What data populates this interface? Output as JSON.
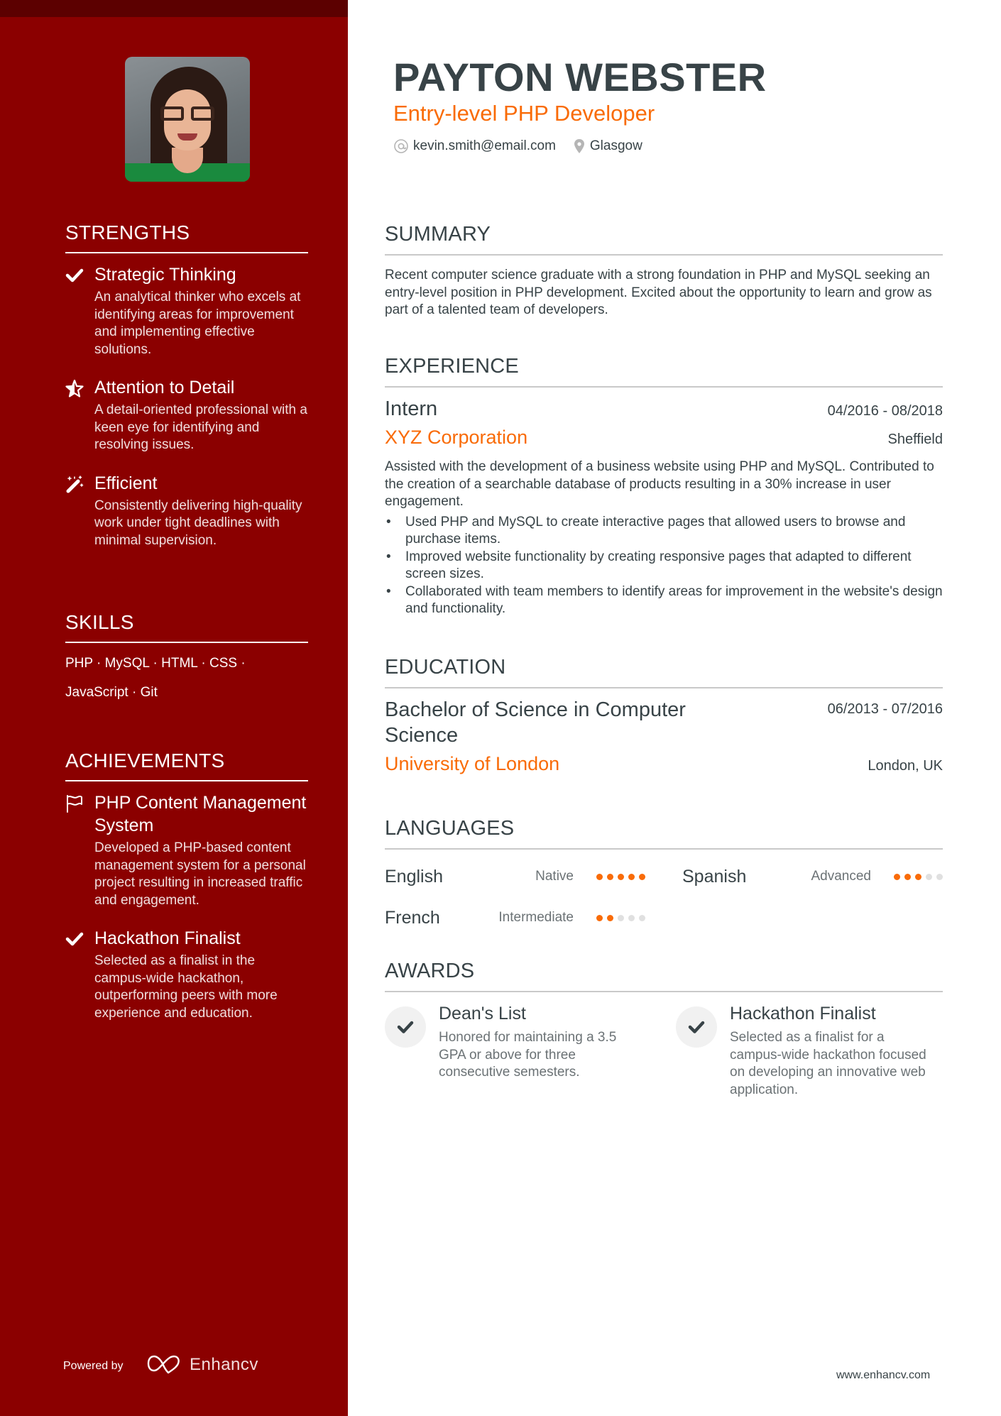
{
  "header": {
    "name": "PAYTON WEBSTER",
    "role": "Entry-level PHP Developer",
    "email": "kevin.smith@email.com",
    "location": "Glasgow",
    "email_icon": "at-icon",
    "location_icon": "map-pin-icon"
  },
  "colors": {
    "sidebar": "#8b0000",
    "sidebar_band": "#5c0000",
    "accent": "#f96b07",
    "text": "#384347",
    "muted": "#6b7275",
    "dot_off": "#e0e0e0"
  },
  "sidebar": {
    "photo_alt": "profile-photo",
    "strengths": {
      "title": "STRENGTHS",
      "items": [
        {
          "icon": "check-icon",
          "title": "Strategic Thinking",
          "desc": "An analytical thinker who excels at identifying areas for improvement and implementing effective solutions."
        },
        {
          "icon": "star-icon",
          "title": "Attention to Detail",
          "desc": "A detail-oriented professional with a keen eye for identifying and resolving issues."
        },
        {
          "icon": "magic-wand-icon",
          "title": "Efficient",
          "desc": "Consistently delivering high-quality work under tight deadlines with minimal supervision."
        }
      ]
    },
    "skills": {
      "title": "SKILLS",
      "items": [
        "PHP",
        "MySQL",
        "HTML",
        "CSS",
        "JavaScript",
        "Git"
      ],
      "line1": "PHP · MySQL · HTML · CSS ·",
      "line2": "JavaScript · Git"
    },
    "achievements": {
      "title": "ACHIEVEMENTS",
      "items": [
        {
          "icon": "flag-icon",
          "title": "PHP Content Management System",
          "desc": "Developed a PHP-based content management system for a personal project resulting in increased traffic and engagement."
        },
        {
          "icon": "check-icon",
          "title": "Hackathon Finalist",
          "desc": "Selected as a finalist in the campus-wide hackathon, outperforming peers with more experience and education."
        }
      ]
    },
    "footer": {
      "powered_by": "Powered by",
      "brand": "Enhancv"
    }
  },
  "main": {
    "summary": {
      "title": "SUMMARY",
      "text": "Recent computer science graduate with a strong foundation in PHP and MySQL seeking an entry-level position in PHP development. Excited about the opportunity to learn and grow as part of a talented team of developers."
    },
    "experience": {
      "title": "EXPERIENCE",
      "items": [
        {
          "title": "Intern",
          "dates": "04/2016 - 08/2018",
          "company": "XYZ Corporation",
          "location": "Sheffield",
          "desc": "Assisted with the development of a business website using PHP and MySQL. Contributed to the creation of a searchable database of products resulting in a 30% increase in user engagement.",
          "bullets": [
            "Used PHP and MySQL to create interactive pages that allowed users to browse and purchase items.",
            "Improved website functionality by creating responsive pages that adapted to different screen sizes.",
            "Collaborated with team members to identify areas for improvement in the website's design and functionality."
          ]
        }
      ]
    },
    "education": {
      "title": "EDUCATION",
      "items": [
        {
          "degree": "Bachelor of Science in Computer Science",
          "dates": "06/2013 - 07/2016",
          "school": "University of London",
          "location": "London, UK"
        }
      ]
    },
    "languages": {
      "title": "LANGUAGES",
      "items": [
        {
          "name": "English",
          "level": "Native",
          "rating": 5,
          "max": 5
        },
        {
          "name": "Spanish",
          "level": "Advanced",
          "rating": 3,
          "max": 5
        },
        {
          "name": "French",
          "level": "Intermediate",
          "rating": 2,
          "max": 5
        }
      ]
    },
    "awards": {
      "title": "AWARDS",
      "items": [
        {
          "icon": "check-icon",
          "title": "Dean's List",
          "desc": "Honored for maintaining a 3.5 GPA or above for three consecutive semesters."
        },
        {
          "icon": "check-icon",
          "title": "Hackathon Finalist",
          "desc": "Selected as a finalist for a campus-wide hackathon focused on developing an innovative web application."
        }
      ]
    },
    "footer": {
      "website": "www.enhancv.com"
    }
  }
}
